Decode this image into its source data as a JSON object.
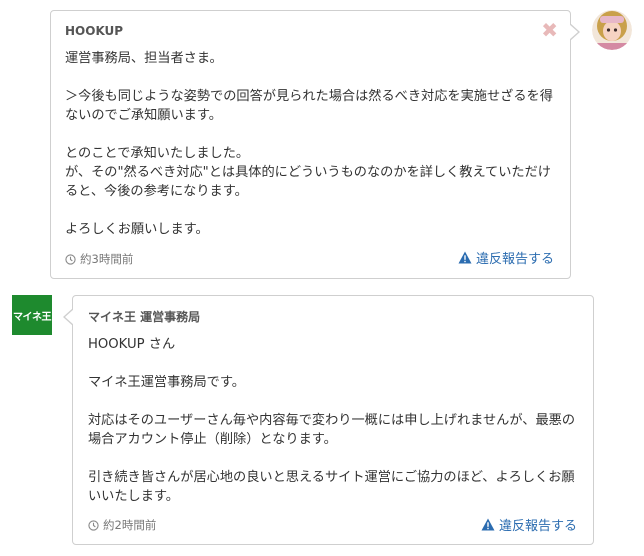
{
  "messages": [
    {
      "sender": "HOOKUP",
      "close_glyph": "✖",
      "body": "運営事務局、担当者さま。\n\n＞今後も同じような姿勢での回答が見られた場合は然るべき対応を実施せざるを得ないのでご承知願います。\n\nとのことで承知いたしました。\nが、その\"然るべき対応\"とは具体的にどういうものなのかを詳しく教えていただけると、今後の参考になります。\n\nよろしくお願いします。",
      "time": "約3時間前",
      "report_label": "違反報告する"
    },
    {
      "sender": "マイネ王 運営事務局",
      "body": "HOOKUP さん\n\nマイネ王運営事務局です。\n\n対応はそのユーザーさん毎や内容毎で変わり一概には申し上げれませんが、最悪の場合アカウント停止（削除）となります。\n\n引き続き皆さんが居心地の良いと思えるサイト運営にご協力のほど、よろしくお願いいたします。",
      "time": "約2時間前",
      "report_label": "違反報告する"
    }
  ],
  "admin_avatar_text": "マイネ王",
  "colors": {
    "link": "#2b6cb0",
    "admin_avatar_bg": "#1e8a2e",
    "close_x": "#e8b9b9",
    "border": "#cfcfcf"
  },
  "icons": {
    "clock": "clock-icon",
    "warning": "warning-icon",
    "close": "close-icon"
  }
}
